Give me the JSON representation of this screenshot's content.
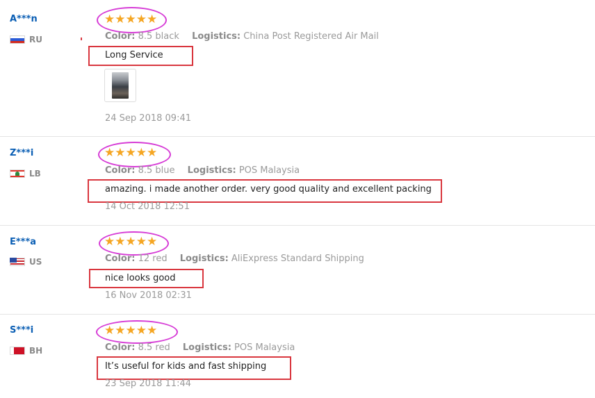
{
  "reviews": [
    {
      "user": "A***n",
      "country": "RU",
      "stars": "★★★★★",
      "color_label": "Color:",
      "color_value": "8.5 black",
      "logistics_label": "Logistics:",
      "logistics_value": "China Post Registered Air Mail",
      "feedback": "Long Service",
      "date": "24 Sep 2018 09:41",
      "has_photo": true
    },
    {
      "user": "Z***i",
      "country": "LB",
      "stars": "★★★★★",
      "color_label": "Color:",
      "color_value": "8.5 blue",
      "logistics_label": "Logistics:",
      "logistics_value": "POS Malaysia",
      "feedback": "amazing. i made another order. very good quality and excellent packing",
      "date": "14 Oct 2018 12:51"
    },
    {
      "user": "E***a",
      "country": "US",
      "stars": "★★★★★",
      "color_label": "Color:",
      "color_value": "12 red",
      "logistics_label": "Logistics:",
      "logistics_value": "AliExpress Standard Shipping",
      "feedback": "nice looks good",
      "date": "16 Nov 2018 02:31"
    },
    {
      "user": "S***i",
      "country": "BH",
      "stars": "★★★★★",
      "color_label": "Color:",
      "color_value": "8.5 red",
      "logistics_label": "Logistics:",
      "logistics_value": "POS Malaysia",
      "feedback": "It’s useful for kids and fast shipping",
      "date": "23 Sep 2018 11:44"
    }
  ],
  "colors": {
    "username": "#0a5eb4",
    "star": "#f5a623",
    "annotation_ellipse": "#d63bd6",
    "annotation_box": "#d9363e"
  }
}
